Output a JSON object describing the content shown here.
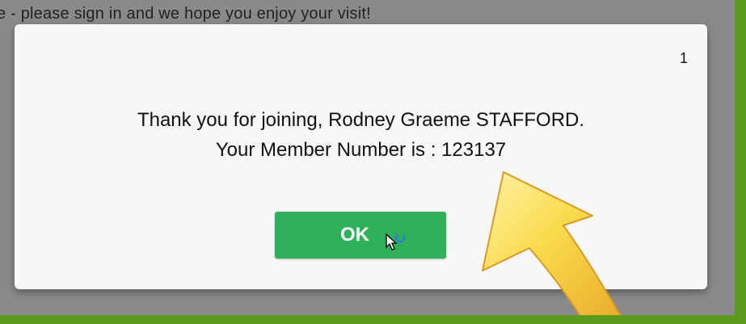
{
  "background": {
    "notice_text": "e - please sign in and we hope you enjoy your visit!"
  },
  "dialog": {
    "counter": "1",
    "message_line1": "Thank you for joining, Rodney Graeme STAFFORD.",
    "message_line2": "Your Member Number is : 123137",
    "ok_label": "OK"
  },
  "colors": {
    "frame": "#5a9a1e",
    "overlay": "#8a8a8a",
    "dialog_bg": "#f7f7f7",
    "ok_button": "#2fb05a",
    "arrow": "#f7d84a"
  },
  "icons": [
    "mouse-pointer-icon",
    "loading-spinner-icon",
    "curved-arrow-icon"
  ]
}
